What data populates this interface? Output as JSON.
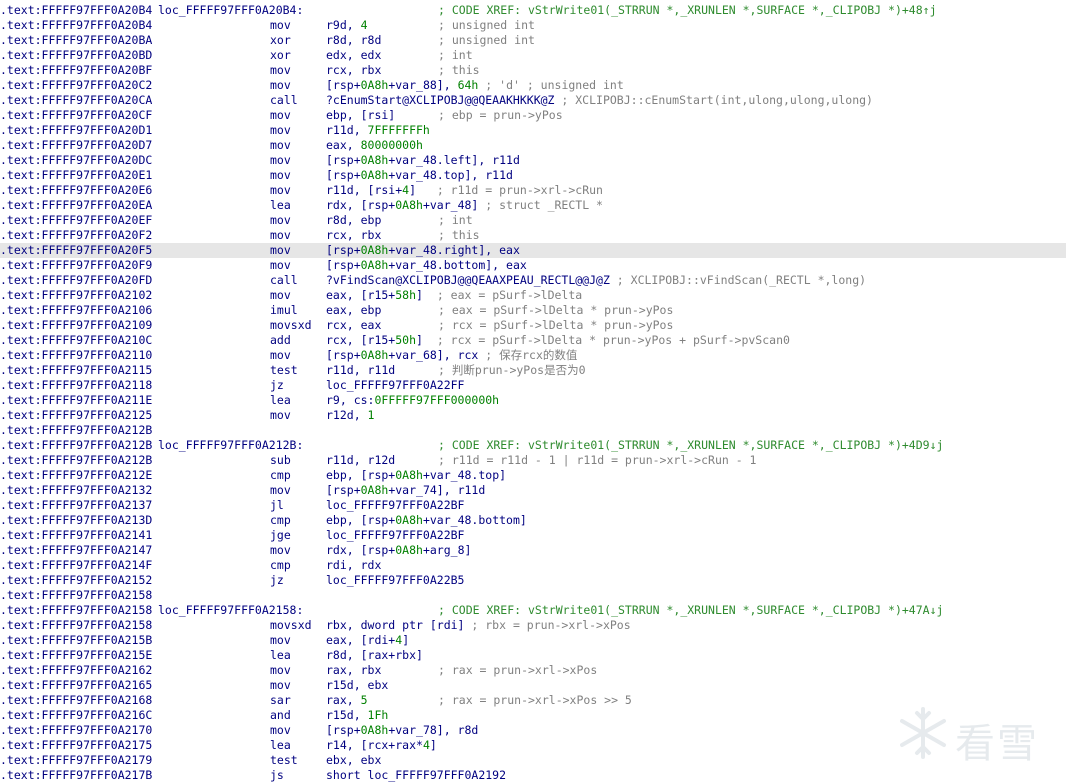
{
  "segment_prefix": ".text:",
  "lines": [
    {
      "addr": "FFFFF97FFF0A20B4",
      "label": "loc_FFFFF97FFF0A20B4:",
      "comment": "; CODE XREF: vStrWrite01(_STRRUN *,_XRUNLEN *,SURFACE *,_CLIPOBJ *)+48↑j"
    },
    {
      "addr": "FFFFF97FFF0A20B4",
      "mn": "mov",
      "op": "r9d, 4",
      "comment": "; unsigned int"
    },
    {
      "addr": "FFFFF97FFF0A20BA",
      "mn": "xor",
      "op": "r8d, r8d",
      "comment": "; unsigned int"
    },
    {
      "addr": "FFFFF97FFF0A20BD",
      "mn": "xor",
      "op": "edx, edx",
      "comment": "; int"
    },
    {
      "addr": "FFFFF97FFF0A20BF",
      "mn": "mov",
      "op": "rcx, rbx",
      "comment": "; this"
    },
    {
      "addr": "FFFFF97FFF0A20C2",
      "mn": "mov",
      "op": "[rsp+0A8h+var_88], 64h ; 'd' ; unsigned int"
    },
    {
      "addr": "FFFFF97FFF0A20CA",
      "mn": "call",
      "op": "?cEnumStart@XCLIPOBJ@@QEAAKHKKK@Z ; XCLIPOBJ::cEnumStart(int,ulong,ulong,ulong)"
    },
    {
      "addr": "FFFFF97FFF0A20CF",
      "mn": "mov",
      "op": "ebp, [rsi]",
      "comment": "; ebp = prun->yPos"
    },
    {
      "addr": "FFFFF97FFF0A20D1",
      "mn": "mov",
      "op": "r11d, 7FFFFFFFh"
    },
    {
      "addr": "FFFFF97FFF0A20D7",
      "mn": "mov",
      "op": "eax, 80000000h"
    },
    {
      "addr": "FFFFF97FFF0A20DC",
      "mn": "mov",
      "op": "[rsp+0A8h+var_48.left], r11d"
    },
    {
      "addr": "FFFFF97FFF0A20E1",
      "mn": "mov",
      "op": "[rsp+0A8h+var_48.top], r11d"
    },
    {
      "addr": "FFFFF97FFF0A20E6",
      "mn": "mov",
      "op": "r11d, [rsi+4]   ; r11d = prun->xrl->cRun"
    },
    {
      "addr": "FFFFF97FFF0A20EA",
      "mn": "lea",
      "op": "rdx, [rsp+0A8h+var_48] ; struct _RECTL *"
    },
    {
      "addr": "FFFFF97FFF0A20EF",
      "mn": "mov",
      "op": "r8d, ebp",
      "comment": "; int"
    },
    {
      "addr": "FFFFF97FFF0A20F2",
      "mn": "mov",
      "op": "rcx, rbx",
      "comment": "; this"
    },
    {
      "addr": "FFFFF97FFF0A20F5",
      "mn": "mov",
      "op": "[rsp+0A8h+var_48.right], eax",
      "hl": true
    },
    {
      "addr": "FFFFF97FFF0A20F9",
      "mn": "mov",
      "op": "[rsp+0A8h+var_48.bottom], eax"
    },
    {
      "addr": "FFFFF97FFF0A20FD",
      "mn": "call",
      "op": "?vFindScan@XCLIPOBJ@@QEAAXPEAU_RECTL@@J@Z ; XCLIPOBJ::vFindScan(_RECTL *,long)"
    },
    {
      "addr": "FFFFF97FFF0A2102",
      "mn": "mov",
      "op": "eax, [r15+58h]  ; eax = pSurf->lDelta"
    },
    {
      "addr": "FFFFF97FFF0A2106",
      "mn": "imul",
      "op": "eax, ebp",
      "comment": "; eax = pSurf->lDelta * prun->yPos"
    },
    {
      "addr": "FFFFF97FFF0A2109",
      "mn": "movsxd",
      "op": "rcx, eax",
      "comment": "; rcx = pSurf->lDelta * prun->yPos"
    },
    {
      "addr": "FFFFF97FFF0A210C",
      "mn": "add",
      "op": "rcx, [r15+50h]  ; rcx = pSurf->lDelta * prun->yPos + pSurf->pvScan0"
    },
    {
      "addr": "FFFFF97FFF0A2110",
      "mn": "mov",
      "op": "[rsp+0A8h+var_68], rcx ; 保存rcx的数值"
    },
    {
      "addr": "FFFFF97FFF0A2115",
      "mn": "test",
      "op": "r11d, r11d",
      "comment": "; 判断prun->yPos是否为0"
    },
    {
      "addr": "FFFFF97FFF0A2118",
      "mn": "jz",
      "op": "loc_FFFFF97FFF0A22FF"
    },
    {
      "addr": "FFFFF97FFF0A211E",
      "mn": "lea",
      "op": "r9, cs:0FFFFF97FFF000000h"
    },
    {
      "addr": "FFFFF97FFF0A2125",
      "mn": "mov",
      "op": "r12d, 1"
    },
    {
      "addr": "FFFFF97FFF0A212B"
    },
    {
      "addr": "FFFFF97FFF0A212B",
      "label": "loc_FFFFF97FFF0A212B:",
      "comment": "; CODE XREF: vStrWrite01(_STRRUN *,_XRUNLEN *,SURFACE *,_CLIPOBJ *)+4D9↓j"
    },
    {
      "addr": "FFFFF97FFF0A212B",
      "mn": "sub",
      "op": "r11d, r12d",
      "comment": "; r11d = r11d - 1 | r11d = prun->xrl->cRun - 1"
    },
    {
      "addr": "FFFFF97FFF0A212E",
      "mn": "cmp",
      "op": "ebp, [rsp+0A8h+var_48.top]"
    },
    {
      "addr": "FFFFF97FFF0A2132",
      "mn": "mov",
      "op": "[rsp+0A8h+var_74], r11d"
    },
    {
      "addr": "FFFFF97FFF0A2137",
      "mn": "jl",
      "op": "loc_FFFFF97FFF0A22BF"
    },
    {
      "addr": "FFFFF97FFF0A213D",
      "mn": "cmp",
      "op": "ebp, [rsp+0A8h+var_48.bottom]"
    },
    {
      "addr": "FFFFF97FFF0A2141",
      "mn": "jge",
      "op": "loc_FFFFF97FFF0A22BF"
    },
    {
      "addr": "FFFFF97FFF0A2147",
      "mn": "mov",
      "op": "rdx, [rsp+0A8h+arg_8]"
    },
    {
      "addr": "FFFFF97FFF0A214F",
      "mn": "cmp",
      "op": "rdi, rdx"
    },
    {
      "addr": "FFFFF97FFF0A2152",
      "mn": "jz",
      "op": "loc_FFFFF97FFF0A22B5"
    },
    {
      "addr": "FFFFF97FFF0A2158"
    },
    {
      "addr": "FFFFF97FFF0A2158",
      "label": "loc_FFFFF97FFF0A2158:",
      "comment": "; CODE XREF: vStrWrite01(_STRRUN *,_XRUNLEN *,SURFACE *,_CLIPOBJ *)+47A↓j"
    },
    {
      "addr": "FFFFF97FFF0A2158",
      "mn": "movsxd",
      "op": "rbx, dword ptr [rdi] ; rbx = prun->xrl->xPos"
    },
    {
      "addr": "FFFFF97FFF0A215B",
      "mn": "mov",
      "op": "eax, [rdi+4]"
    },
    {
      "addr": "FFFFF97FFF0A215E",
      "mn": "lea",
      "op": "r8d, [rax+rbx]"
    },
    {
      "addr": "FFFFF97FFF0A2162",
      "mn": "mov",
      "op": "rax, rbx",
      "comment": "; rax = prun->xrl->xPos"
    },
    {
      "addr": "FFFFF97FFF0A2165",
      "mn": "mov",
      "op": "r15d, ebx"
    },
    {
      "addr": "FFFFF97FFF0A2168",
      "mn": "sar",
      "op": "rax, 5",
      "comment": "; rax = prun->xrl->xPos >> 5"
    },
    {
      "addr": "FFFFF97FFF0A216C",
      "mn": "and",
      "op": "r15d, 1Fh"
    },
    {
      "addr": "FFFFF97FFF0A2170",
      "mn": "mov",
      "op": "[rsp+0A8h+var_78], r8d"
    },
    {
      "addr": "FFFFF97FFF0A2175",
      "mn": "lea",
      "op": "r14, [rcx+rax*4]"
    },
    {
      "addr": "FFFFF97FFF0A2179",
      "mn": "test",
      "op": "ebx, ebx"
    },
    {
      "addr": "FFFFF97FFF0A217B",
      "mn": "js",
      "op": "short loc_FFFFF97FFF0A2192"
    }
  ],
  "watermark": {
    "text": "看雪",
    "icon": "snowflake-logo-icon"
  }
}
